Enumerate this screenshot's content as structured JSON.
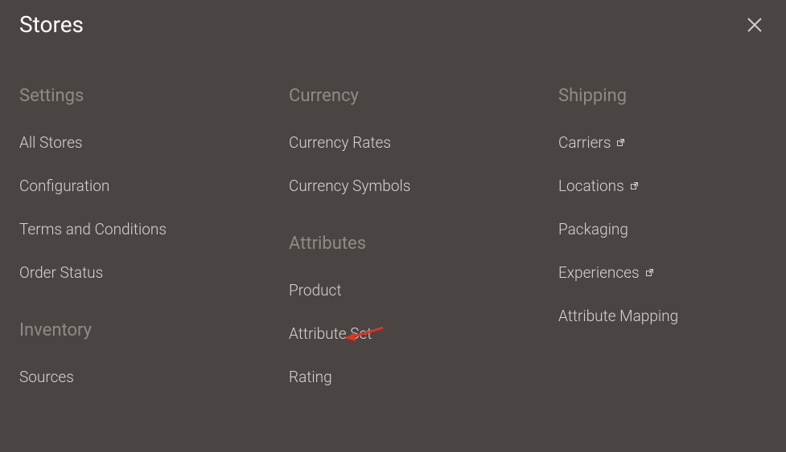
{
  "page_title": "Stores",
  "columns": [
    {
      "sections": [
        {
          "heading": "Settings",
          "items": [
            {
              "label": "All Stores",
              "external": false
            },
            {
              "label": "Configuration",
              "external": false
            },
            {
              "label": "Terms and Conditions",
              "external": false
            },
            {
              "label": "Order Status",
              "external": false
            }
          ]
        },
        {
          "heading": "Inventory",
          "items": [
            {
              "label": "Sources",
              "external": false
            }
          ]
        }
      ]
    },
    {
      "sections": [
        {
          "heading": "Currency",
          "items": [
            {
              "label": "Currency Rates",
              "external": false
            },
            {
              "label": "Currency Symbols",
              "external": false
            }
          ]
        },
        {
          "heading": "Attributes",
          "items": [
            {
              "label": "Product",
              "external": false
            },
            {
              "label": "Attribute Set",
              "external": false
            },
            {
              "label": "Rating",
              "external": false
            }
          ]
        }
      ]
    },
    {
      "sections": [
        {
          "heading": "Shipping",
          "items": [
            {
              "label": "Carriers",
              "external": true
            },
            {
              "label": "Locations",
              "external": true
            },
            {
              "label": "Packaging",
              "external": false
            },
            {
              "label": "Experiences",
              "external": true
            },
            {
              "label": "Attribute Mapping",
              "external": false
            }
          ]
        }
      ]
    }
  ]
}
